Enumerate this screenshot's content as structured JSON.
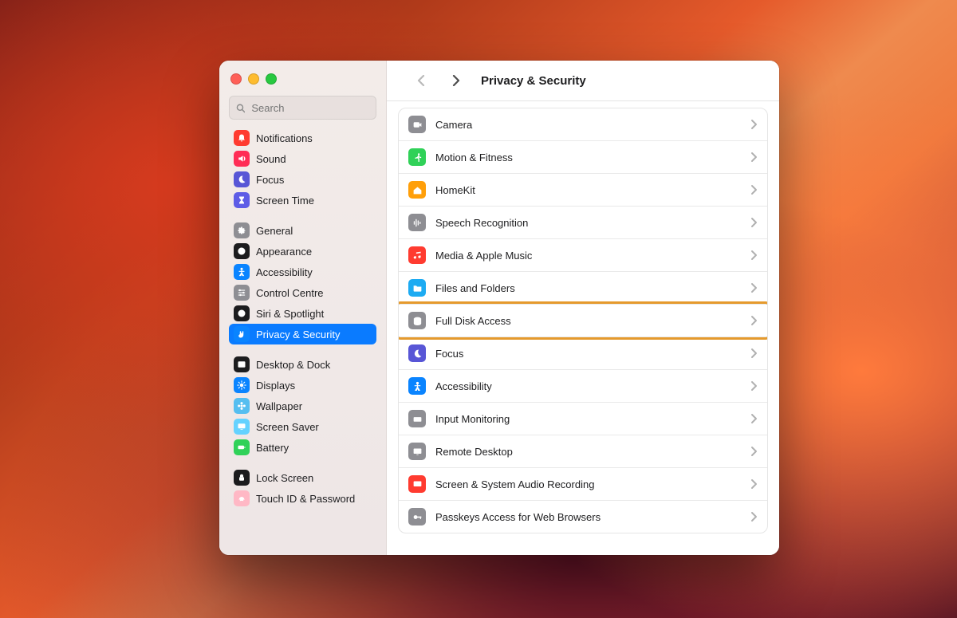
{
  "window_title": "Privacy & Security",
  "search": {
    "placeholder": "Search",
    "value": ""
  },
  "sidebar": {
    "groups": [
      {
        "items": [
          {
            "id": "notifications",
            "label": "Notifications",
            "color": "#ff3b30",
            "icon": "bell",
            "selected": false
          },
          {
            "id": "sound",
            "label": "Sound",
            "color": "#ff2d55",
            "icon": "speaker",
            "selected": false
          },
          {
            "id": "focus",
            "label": "Focus",
            "color": "#5856d6",
            "icon": "moon",
            "selected": false
          },
          {
            "id": "screen-time",
            "label": "Screen Time",
            "color": "#5e5ce6",
            "icon": "hourglass",
            "selected": false
          }
        ]
      },
      {
        "items": [
          {
            "id": "general",
            "label": "General",
            "color": "#8e8e93",
            "icon": "gear",
            "selected": false
          },
          {
            "id": "appearance",
            "label": "Appearance",
            "color": "#1c1c1e",
            "icon": "contrast",
            "selected": false
          },
          {
            "id": "accessibility-side",
            "label": "Accessibility",
            "color": "#0a84ff",
            "icon": "figure",
            "selected": false
          },
          {
            "id": "control-centre",
            "label": "Control Centre",
            "color": "#8e8e93",
            "icon": "sliders",
            "selected": false
          },
          {
            "id": "siri-spotlight",
            "label": "Siri & Spotlight",
            "color": "#1c1c1e",
            "icon": "siri",
            "selected": false
          },
          {
            "id": "privacy",
            "label": "Privacy & Security",
            "color": "#0a84ff",
            "icon": "hand",
            "selected": true
          }
        ]
      },
      {
        "items": [
          {
            "id": "desktop-dock",
            "label": "Desktop & Dock",
            "color": "#1c1c1e",
            "icon": "dock",
            "selected": false
          },
          {
            "id": "displays",
            "label": "Displays",
            "color": "#0a84ff",
            "icon": "sun",
            "selected": false
          },
          {
            "id": "wallpaper",
            "label": "Wallpaper",
            "color": "#55bef0",
            "icon": "flower",
            "selected": false
          },
          {
            "id": "screen-saver",
            "label": "Screen Saver",
            "color": "#64d2ff",
            "icon": "screen",
            "selected": false
          },
          {
            "id": "battery",
            "label": "Battery",
            "color": "#30d158",
            "icon": "battery",
            "selected": false
          }
        ]
      },
      {
        "items": [
          {
            "id": "lock-screen",
            "label": "Lock Screen",
            "color": "#1c1c1e",
            "icon": "lock",
            "selected": false
          },
          {
            "id": "touch-id",
            "label": "Touch ID & Password",
            "color": "#ffb8c5",
            "icon": "fingerprint",
            "selected": false
          }
        ]
      }
    ]
  },
  "main": {
    "rows": [
      {
        "id": "camera",
        "label": "Camera",
        "color": "#8e8e93",
        "icon": "camera",
        "highlight": false
      },
      {
        "id": "motion-fitness",
        "label": "Motion & Fitness",
        "color": "#30d158",
        "icon": "runner",
        "highlight": false
      },
      {
        "id": "homekit",
        "label": "HomeKit",
        "color": "#ff9f0a",
        "icon": "home",
        "highlight": false
      },
      {
        "id": "speech",
        "label": "Speech Recognition",
        "color": "#8e8e93",
        "icon": "waveform",
        "highlight": false
      },
      {
        "id": "media-music",
        "label": "Media & Apple Music",
        "color": "#ff3b30",
        "icon": "music",
        "highlight": false
      },
      {
        "id": "files-folders",
        "label": "Files and Folders",
        "color": "#1dabf2",
        "icon": "folder",
        "highlight": false
      },
      {
        "id": "full-disk",
        "label": "Full Disk Access",
        "color": "#8e8e93",
        "icon": "disk",
        "highlight": true
      },
      {
        "id": "focus-main",
        "label": "Focus",
        "color": "#5856d6",
        "icon": "moon",
        "highlight": false
      },
      {
        "id": "accessibility",
        "label": "Accessibility",
        "color": "#0a84ff",
        "icon": "figure",
        "highlight": false
      },
      {
        "id": "input-monitoring",
        "label": "Input Monitoring",
        "color": "#8e8e93",
        "icon": "keyboard",
        "highlight": false
      },
      {
        "id": "remote-desktop",
        "label": "Remote Desktop",
        "color": "#8e8e93",
        "icon": "display",
        "highlight": false
      },
      {
        "id": "screen-audio",
        "label": "Screen & System Audio Recording",
        "color": "#ff3b30",
        "icon": "record",
        "highlight": false
      },
      {
        "id": "passkeys",
        "label": "Passkeys Access for Web Browsers",
        "color": "#8e8e93",
        "icon": "key",
        "highlight": false
      }
    ]
  }
}
